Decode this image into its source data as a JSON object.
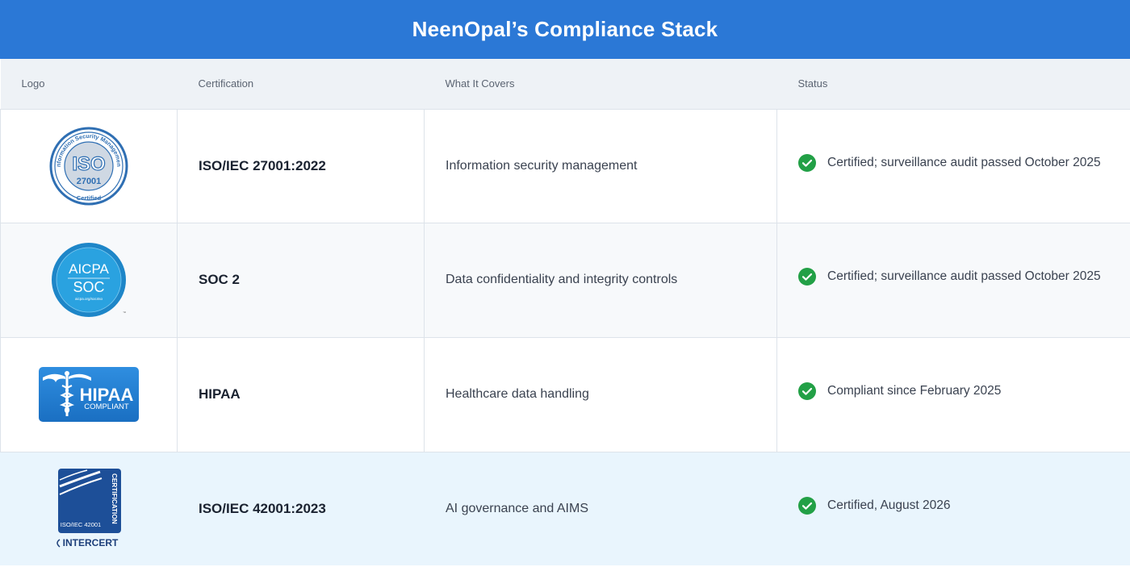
{
  "banner": {
    "title": "NeenOpal’s Compliance Stack"
  },
  "table": {
    "headers": [
      "Logo",
      "Certification",
      "What It Covers",
      "Status"
    ],
    "rows": [
      {
        "logo": {
          "icon": "iso-27001-certified-badge",
          "ring_text": "Information Security Management",
          "main": "ISO",
          "number": "27001",
          "footer": "Certified"
        },
        "certification": "ISO/IEC 27001:2022",
        "covers": "Information security management",
        "status": "Certified; surveillance audit passed October 2025"
      },
      {
        "logo": {
          "icon": "aicpa-soc-badge",
          "line1": "AICPA",
          "line2": "SOC",
          "small": "aicpa.org/soc4so"
        },
        "certification": "SOC 2",
        "covers": "Data confidentiality and integrity controls",
        "status": "Certified; surveillance audit passed October 2025"
      },
      {
        "logo": {
          "icon": "hipaa-compliant-badge",
          "main": "HIPAA",
          "sub": "COMPLIANT"
        },
        "certification": "HIPAA",
        "covers": "Healthcare data handling",
        "status": "Compliant since February 2025"
      },
      {
        "logo": {
          "icon": "intercert-iso-42001-badge",
          "side": "CERTIFICATION",
          "code": "ISO/IEC 42001",
          "brand": "INTERCERT"
        },
        "certification": "ISO/IEC 42001:2023",
        "covers": "AI governance and AIMS",
        "status": "Certified, August 2026"
      }
    ]
  },
  "colors": {
    "banner": "#2b78d6",
    "check": "#22a046",
    "header_bg": "#eef2f6",
    "highlight_row": "#e9f5fd"
  }
}
